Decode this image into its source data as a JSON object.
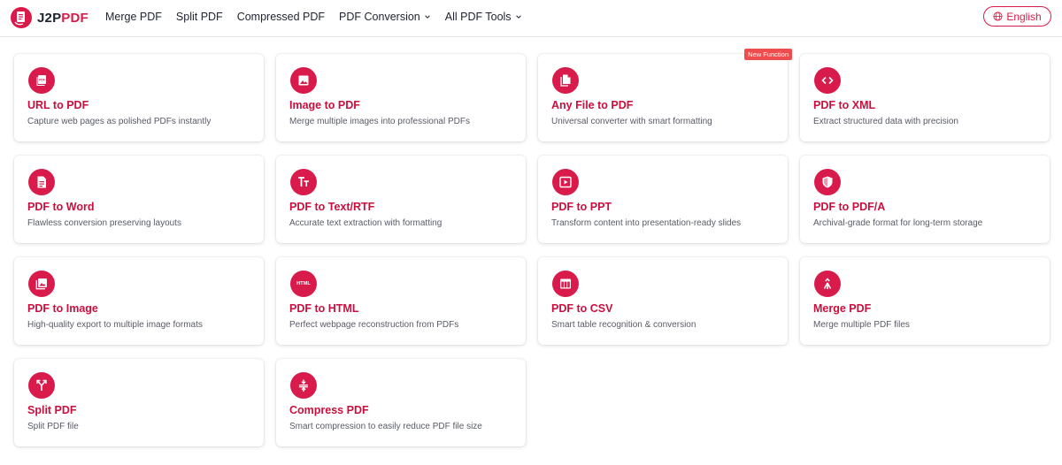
{
  "brand": {
    "name_prefix": "J2P",
    "name_suffix": "PDF"
  },
  "nav": {
    "items": [
      {
        "label": "Merge PDF"
      },
      {
        "label": "Split PDF"
      },
      {
        "label": "Compressed PDF"
      },
      {
        "label": "PDF Conversion"
      },
      {
        "label": "All PDF Tools"
      }
    ],
    "language": "English"
  },
  "colors": {
    "accent": "#d81b4a",
    "title": "#c8103e",
    "badge": "#ef4d4d"
  },
  "tools": [
    {
      "icon": "pdf-file-icon",
      "title": "URL to PDF",
      "desc": "Capture web pages as polished PDFs instantly"
    },
    {
      "icon": "image-icon",
      "title": "Image to PDF",
      "desc": "Merge multiple images into professional PDFs"
    },
    {
      "icon": "files-icon",
      "title": "Any File to PDF",
      "desc": "Universal converter with smart formatting",
      "badge": "New Function"
    },
    {
      "icon": "code-icon",
      "title": "PDF to XML",
      "desc": "Extract structured data with precision"
    },
    {
      "icon": "document-icon",
      "title": "PDF to Word",
      "desc": "Flawless conversion preserving layouts"
    },
    {
      "icon": "text-format-icon",
      "title": "PDF to Text/RTF",
      "desc": "Accurate text extraction with formatting"
    },
    {
      "icon": "slideshow-icon",
      "title": "PDF to PPT",
      "desc": "Transform content into presentation-ready slides"
    },
    {
      "icon": "shield-icon",
      "title": "PDF to PDF/A",
      "desc": "Archival-grade format for long-term storage"
    },
    {
      "icon": "photo-library-icon",
      "title": "PDF to Image",
      "desc": "High-quality export to multiple image formats"
    },
    {
      "icon": "html-icon",
      "title": "PDF to HTML",
      "desc": "Perfect webpage reconstruction from PDFs",
      "icon_text": "HTML"
    },
    {
      "icon": "table-icon",
      "title": "PDF to CSV",
      "desc": "Smart table recognition & conversion"
    },
    {
      "icon": "merge-icon",
      "title": "Merge PDF",
      "desc": "Merge multiple PDF files"
    },
    {
      "icon": "split-icon",
      "title": "Split PDF",
      "desc": "Split PDF file"
    },
    {
      "icon": "compress-icon",
      "title": "Compress PDF",
      "desc": "Smart compression to easily reduce PDF file size"
    }
  ]
}
